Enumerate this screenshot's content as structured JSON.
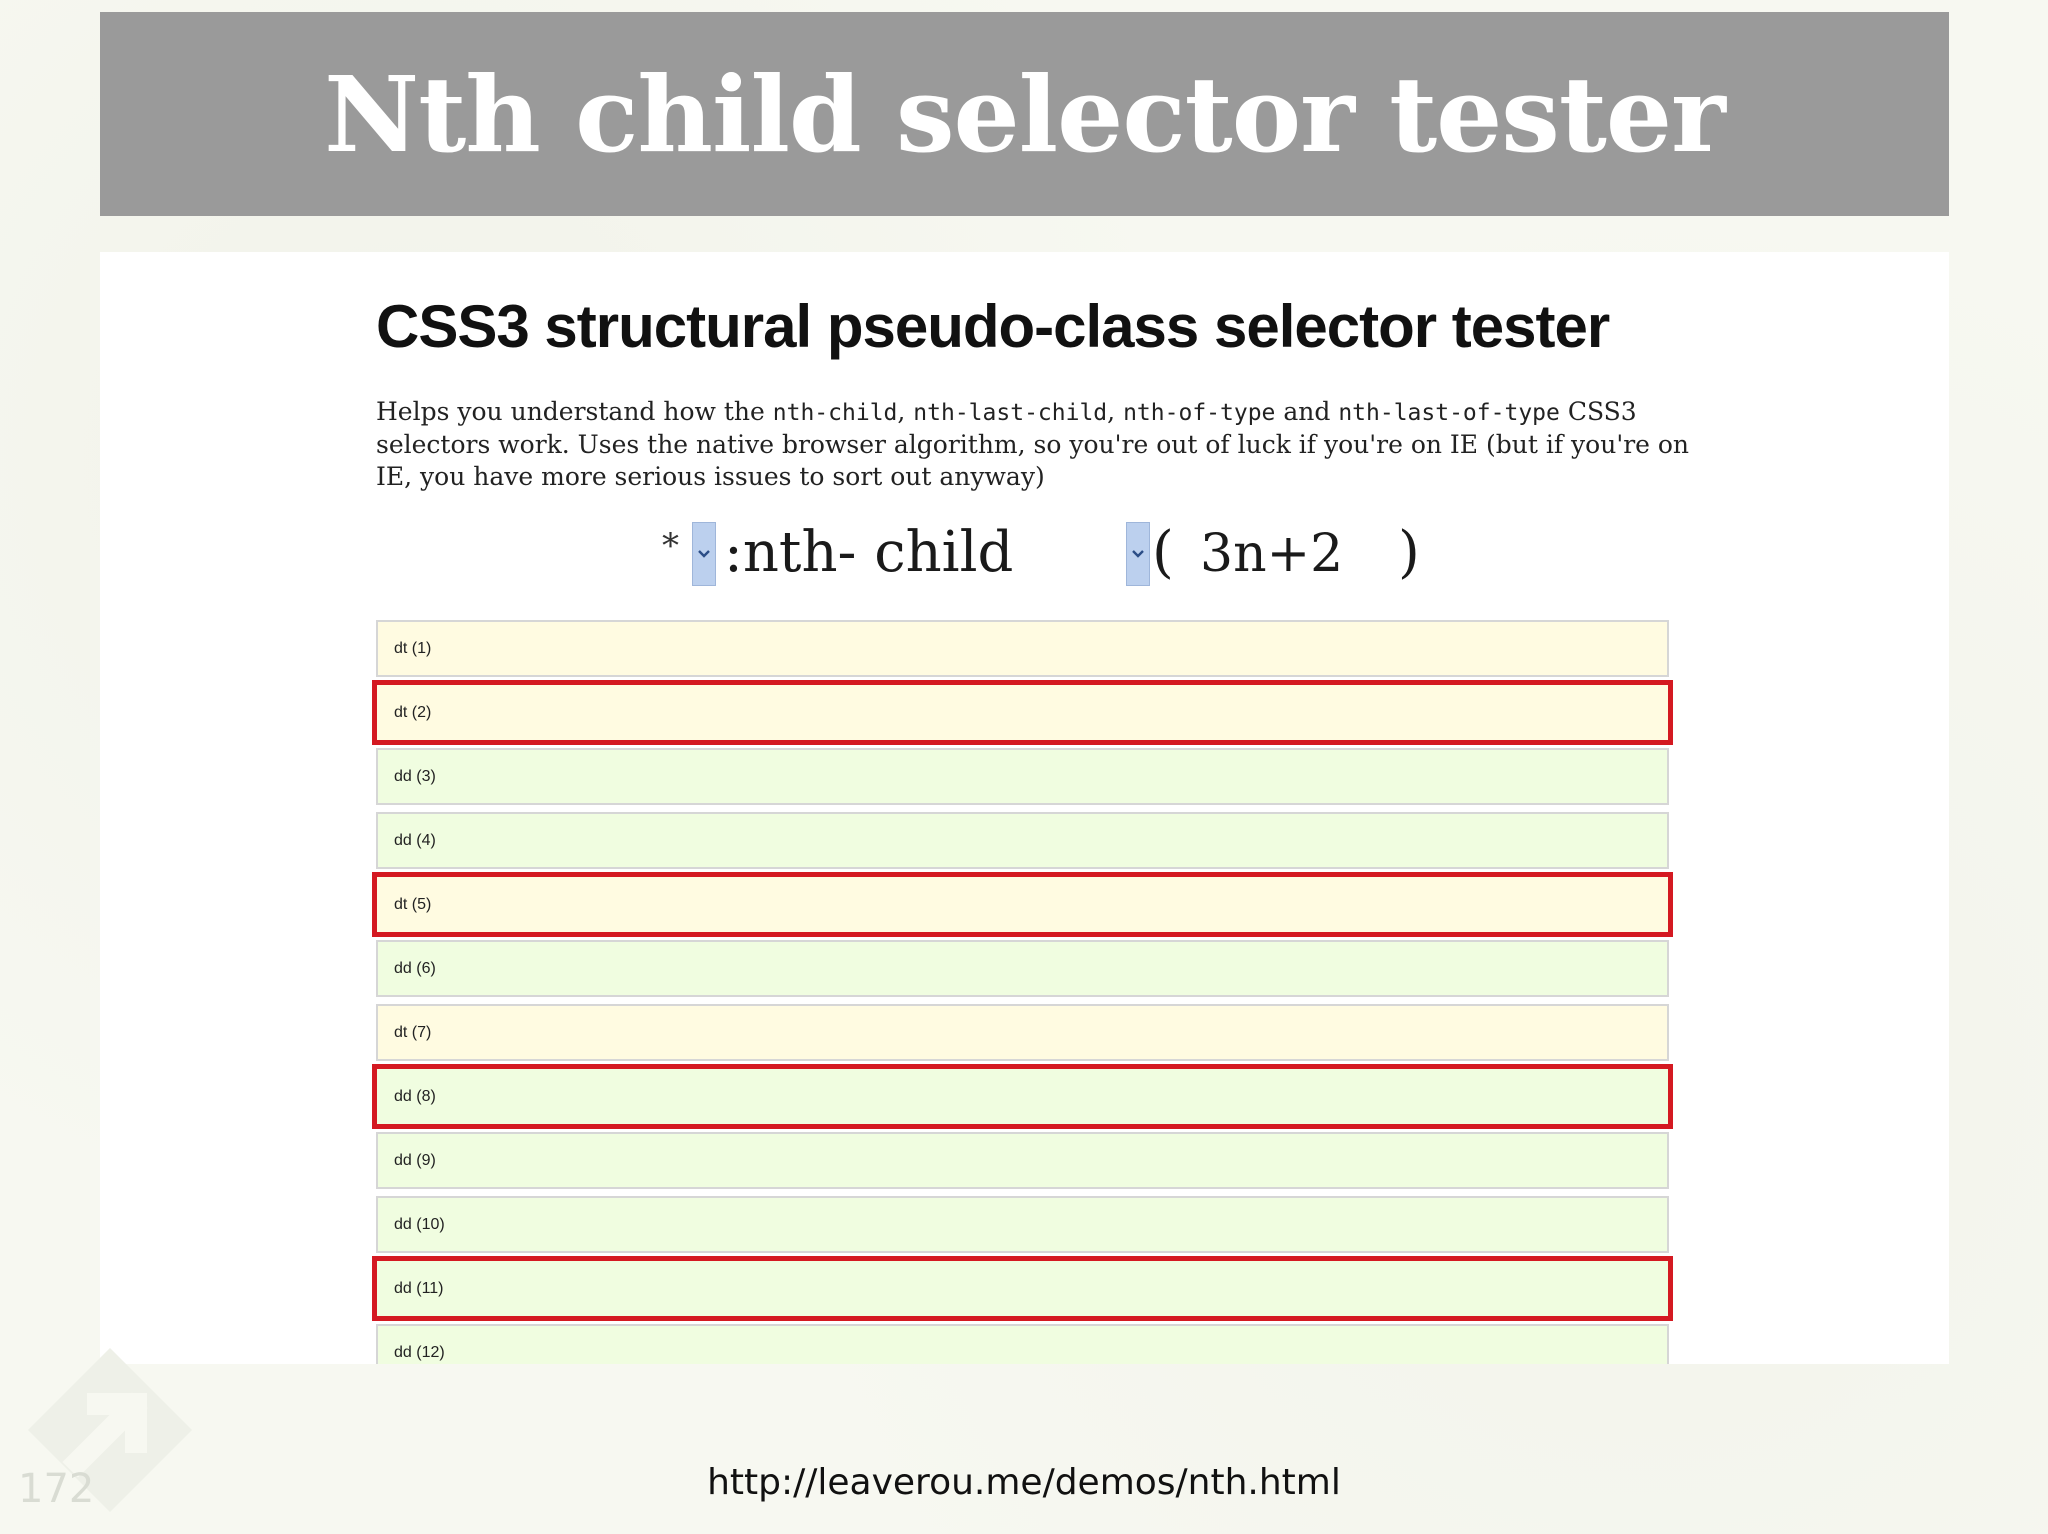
{
  "slide": {
    "title": "Nth child selector tester",
    "page_number": "172",
    "footer_url": "http://leaverou.me/demos/nth.html"
  },
  "demo": {
    "heading": "CSS3 structural pseudo-class selector tester",
    "description": {
      "prefix": "Helps you understand how the ",
      "code1": "nth-child",
      "sep1": ", ",
      "code2": "nth-last-child",
      "sep2": ", ",
      "code3": "nth-of-type",
      "sep3": " and ",
      "code4": "nth-last-of-type",
      "suffix": " CSS3 selectors work. Uses the native browser algorithm, so you're out of luck if you're on IE (but if you're on IE, you have more serious issues to sort out anyway)"
    },
    "selector": {
      "element": "*",
      "pseudo": ":nth- child",
      "open_paren": "(",
      "formula": "3n+2",
      "close_paren": ")"
    },
    "rows": [
      {
        "label": "dt (1)",
        "type": "dt",
        "highlighted": false
      },
      {
        "label": "dt (2)",
        "type": "dt",
        "highlighted": true
      },
      {
        "label": "dd (3)",
        "type": "dd",
        "highlighted": false
      },
      {
        "label": "dd (4)",
        "type": "dd",
        "highlighted": false
      },
      {
        "label": "dt (5)",
        "type": "dt",
        "highlighted": true
      },
      {
        "label": "dd (6)",
        "type": "dd",
        "highlighted": false
      },
      {
        "label": "dt (7)",
        "type": "dt",
        "highlighted": false
      },
      {
        "label": "dd (8)",
        "type": "dd",
        "highlighted": true
      },
      {
        "label": "dd (9)",
        "type": "dd",
        "highlighted": false
      },
      {
        "label": "dd (10)",
        "type": "dd",
        "highlighted": false
      },
      {
        "label": "dd (11)",
        "type": "dd",
        "highlighted": true
      },
      {
        "label": "dd (12)",
        "type": "dd",
        "highlighted": false
      }
    ]
  },
  "colors": {
    "title_bar": "#9a9a9a",
    "highlight_border": "#d41921",
    "dt_background": "#fffbe1",
    "dd_background": "#f0fde0"
  },
  "icons": {
    "corner_logo": "arrow-up-right-icon",
    "dropdown": "chevron-down-icon"
  }
}
